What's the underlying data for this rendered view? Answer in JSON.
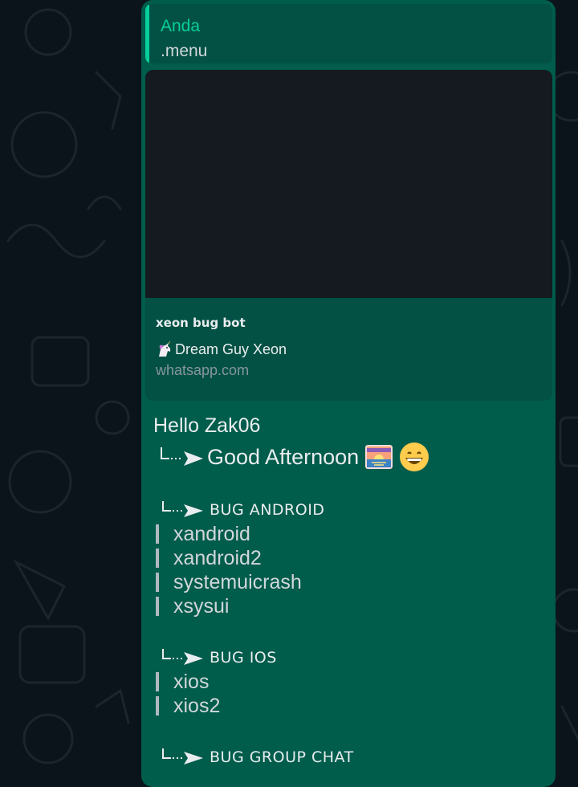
{
  "quote": {
    "author": "Anda",
    "text": ".menu"
  },
  "link_preview": {
    "title": "xeon bug bot",
    "description": "Dream Guy Xeon",
    "domain": "whatsapp.com",
    "icon": "unicorn-icon"
  },
  "message": {
    "greeting": "Hello Zak06",
    "time_greeting": "Good Afternoon",
    "emoji_icons": [
      "sunset-icon",
      "grinning-face-icon"
    ],
    "sections": [
      {
        "title": "BUG ANDROID",
        "items": [
          "xandroid",
          "xandroid2",
          "systemuicrash",
          "xsysui"
        ]
      },
      {
        "title": "BUG IOS",
        "items": [
          "xios",
          "xios2"
        ]
      },
      {
        "title": "BUG GROUP CHAT",
        "items": []
      }
    ]
  },
  "colors": {
    "bubble": "#005c4b",
    "quote_accent": "#06cf9c",
    "background": "#0b141a"
  }
}
